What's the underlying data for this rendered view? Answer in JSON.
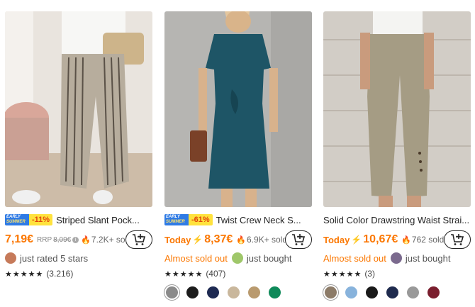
{
  "products": [
    {
      "promo": {
        "line1": "EARLY",
        "line2": "SUMMER",
        "discount": "-11%"
      },
      "title": "Striped Slant Pock...",
      "price": "7,19€",
      "rrp_label": "RRP",
      "rrp_value": "8,09€",
      "sold": "7.2K+ sold",
      "social": "just rated 5 stars",
      "stars": "★★★★★",
      "rating_count": "(3.216)"
    },
    {
      "promo": {
        "line1": "EARLY",
        "line2": "SUMMER",
        "discount": "-61%"
      },
      "title": "Twist Crew Neck S...",
      "today": "Today",
      "price": "8,37€",
      "sold": "6.9K+ sold",
      "urgency": "Almost sold out",
      "social": "just bought",
      "stars": "★★★★★",
      "rating_count": "(407)",
      "swatches": [
        "#8a8a8a",
        "#1c1c1c",
        "#1e2a52",
        "#c9b79c",
        "#b99a6e",
        "#0f8a5a"
      ]
    },
    {
      "title": "Solid Color Drawstring Waist Strai...",
      "today": "Today",
      "price": "10,67€",
      "sold": "762 sold",
      "urgency": "Almost sold out",
      "social": "just bought",
      "stars": "★★★★★",
      "rating_count": "(3)",
      "swatches": [
        "#8c7b68",
        "#88b3dc",
        "#1a1a1a",
        "#1f2b4e",
        "#999999",
        "#7a1e2e"
      ]
    }
  ],
  "icons": {
    "cart": "add-to-cart-icon",
    "bolt": "lightning-icon",
    "flame": "flame-icon",
    "info": "info-icon"
  },
  "colors": {
    "accent": "#fb7701",
    "promo_blue": "#2f7be5",
    "promo_yellow": "#ffe23d"
  }
}
